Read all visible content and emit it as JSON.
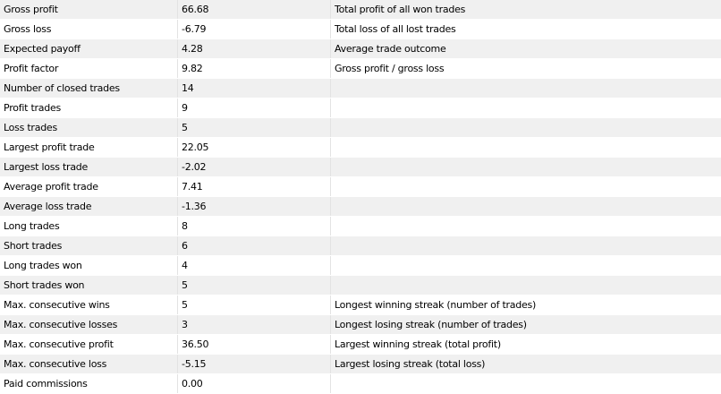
{
  "colors": {
    "row_alt_background": "#f0f0f0",
    "row_background": "#ffffff",
    "grid_line": "#e3e3e3",
    "text": "#000000"
  },
  "rows": [
    {
      "name": "Gross profit",
      "value": "66.68",
      "description": "Total profit of all won trades"
    },
    {
      "name": "Gross loss",
      "value": "-6.79",
      "description": "Total loss of all lost trades"
    },
    {
      "name": "Expected payoff",
      "value": "4.28",
      "description": "Average trade outcome"
    },
    {
      "name": "Profit factor",
      "value": "9.82",
      "description": "Gross profit / gross loss"
    },
    {
      "name": "Number of closed trades",
      "value": "14",
      "description": ""
    },
    {
      "name": "Profit trades",
      "value": "9",
      "description": ""
    },
    {
      "name": "Loss trades",
      "value": "5",
      "description": ""
    },
    {
      "name": "Largest profit trade",
      "value": "22.05",
      "description": ""
    },
    {
      "name": "Largest loss trade",
      "value": "-2.02",
      "description": ""
    },
    {
      "name": "Average profit trade",
      "value": "7.41",
      "description": ""
    },
    {
      "name": "Average loss trade",
      "value": "-1.36",
      "description": ""
    },
    {
      "name": "Long trades",
      "value": "8",
      "description": ""
    },
    {
      "name": "Short trades",
      "value": "6",
      "description": ""
    },
    {
      "name": "Long trades won",
      "value": "4",
      "description": ""
    },
    {
      "name": "Short trades won",
      "value": "5",
      "description": ""
    },
    {
      "name": "Max. consecutive wins",
      "value": "5",
      "description": "Longest winning streak (number of trades)"
    },
    {
      "name": "Max. consecutive losses",
      "value": "3",
      "description": "Longest losing streak (number of trades)"
    },
    {
      "name": "Max. consecutive profit",
      "value": "36.50",
      "description": "Largest winning streak (total profit)"
    },
    {
      "name": "Max. consecutive loss",
      "value": "-5.15",
      "description": "Largest losing streak (total loss)"
    },
    {
      "name": "Paid commissions",
      "value": "0.00",
      "description": ""
    }
  ]
}
